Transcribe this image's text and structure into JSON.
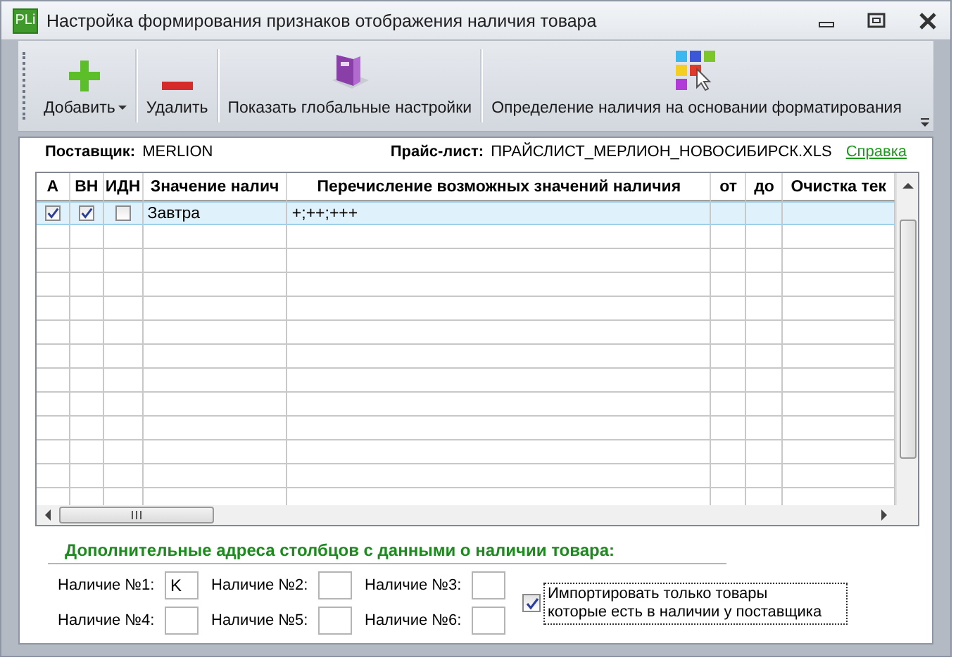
{
  "window": {
    "app_icon": "PLi",
    "title": "Настройка формирования признаков отображения наличия товара"
  },
  "toolbar": [
    {
      "kind": "add",
      "label": "Добавить",
      "dropdown": true
    },
    {
      "kind": "delete",
      "label": "Удалить",
      "dropdown": false
    },
    {
      "kind": "settings",
      "label": "Показать глобальные настройки",
      "dropdown": false
    },
    {
      "kind": "format",
      "label": "Определение наличия на основании форматирования",
      "dropdown": false
    }
  ],
  "info": {
    "supplier_label": "Поставщик:",
    "supplier": "MERLION",
    "pricelist_label": "Прайс-лист:",
    "pricelist": "ПРАЙСЛИСТ_МЕРЛИОН_НОВОСИБИРСК.XLS",
    "help_link": "Справка"
  },
  "table": {
    "columns": [
      "А",
      "ВН",
      "ИДН",
      "Значение налич",
      "Перечисление возможных значений наличия",
      "от",
      "до",
      "Очистка тек"
    ],
    "rows": [
      {
        "selected": true,
        "cells": [
          true,
          true,
          false,
          "Завтра",
          "+;++;+++"
        ]
      }
    ]
  },
  "section": {
    "title": "Дополнительные адреса столбцов с данными о наличии товара:",
    "fields": [
      {
        "label": "Наличие №1:",
        "value": "K"
      },
      {
        "label": "Наличие №2:"
      },
      {
        "label": "Наличие №3:"
      },
      {
        "label": "Наличие №4:"
      },
      {
        "label": "Наличие №5:"
      },
      {
        "label": "Наличие №6:"
      }
    ],
    "checkbox": {
      "lines": [
        "Импортировать только товары",
        "которые есть в наличии у поставщика"
      ],
      "checked": true
    }
  }
}
